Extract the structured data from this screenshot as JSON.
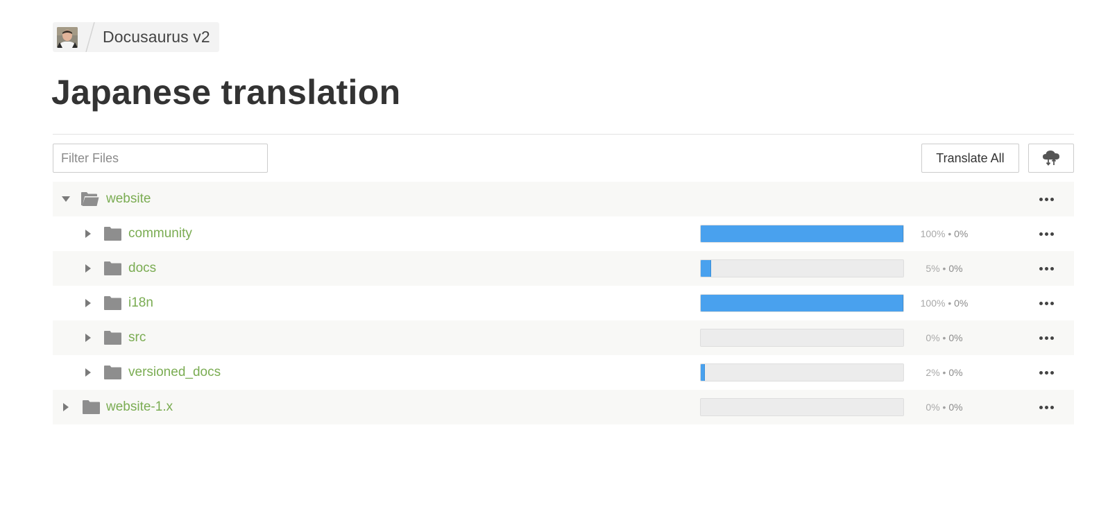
{
  "breadcrumb": {
    "project": "Docusaurus v2"
  },
  "page": {
    "title": "Japanese translation"
  },
  "toolbar": {
    "filter_placeholder": "Filter Files",
    "translate_all_label": "Translate All",
    "upload_icon": "cloud-upload-download-icon"
  },
  "colors": {
    "link_green": "#7aac52",
    "progress_blue": "#49a1ee",
    "row_alt_bg": "#f8f8f6"
  },
  "tree": [
    {
      "name": "website",
      "level": 0,
      "expanded": true,
      "show_progress": false
    },
    {
      "name": "community",
      "level": 1,
      "expanded": false,
      "show_progress": true,
      "translated": "100%",
      "approved": "0%",
      "progress": 1.0
    },
    {
      "name": "docs",
      "level": 1,
      "expanded": false,
      "show_progress": true,
      "translated": "5%",
      "approved": "0%",
      "progress": 0.05
    },
    {
      "name": "i18n",
      "level": 1,
      "expanded": false,
      "show_progress": true,
      "translated": "100%",
      "approved": "0%",
      "progress": 1.0
    },
    {
      "name": "src",
      "level": 1,
      "expanded": false,
      "show_progress": true,
      "translated": "0%",
      "approved": "0%",
      "progress": 0.0
    },
    {
      "name": "versioned_docs",
      "level": 1,
      "expanded": false,
      "show_progress": true,
      "translated": "2%",
      "approved": "0%",
      "progress": 0.02
    },
    {
      "name": "website-1.x",
      "level": 0,
      "expanded": false,
      "show_progress": true,
      "translated": "0%",
      "approved": "0%",
      "progress": 0.0
    }
  ],
  "separator": "•"
}
